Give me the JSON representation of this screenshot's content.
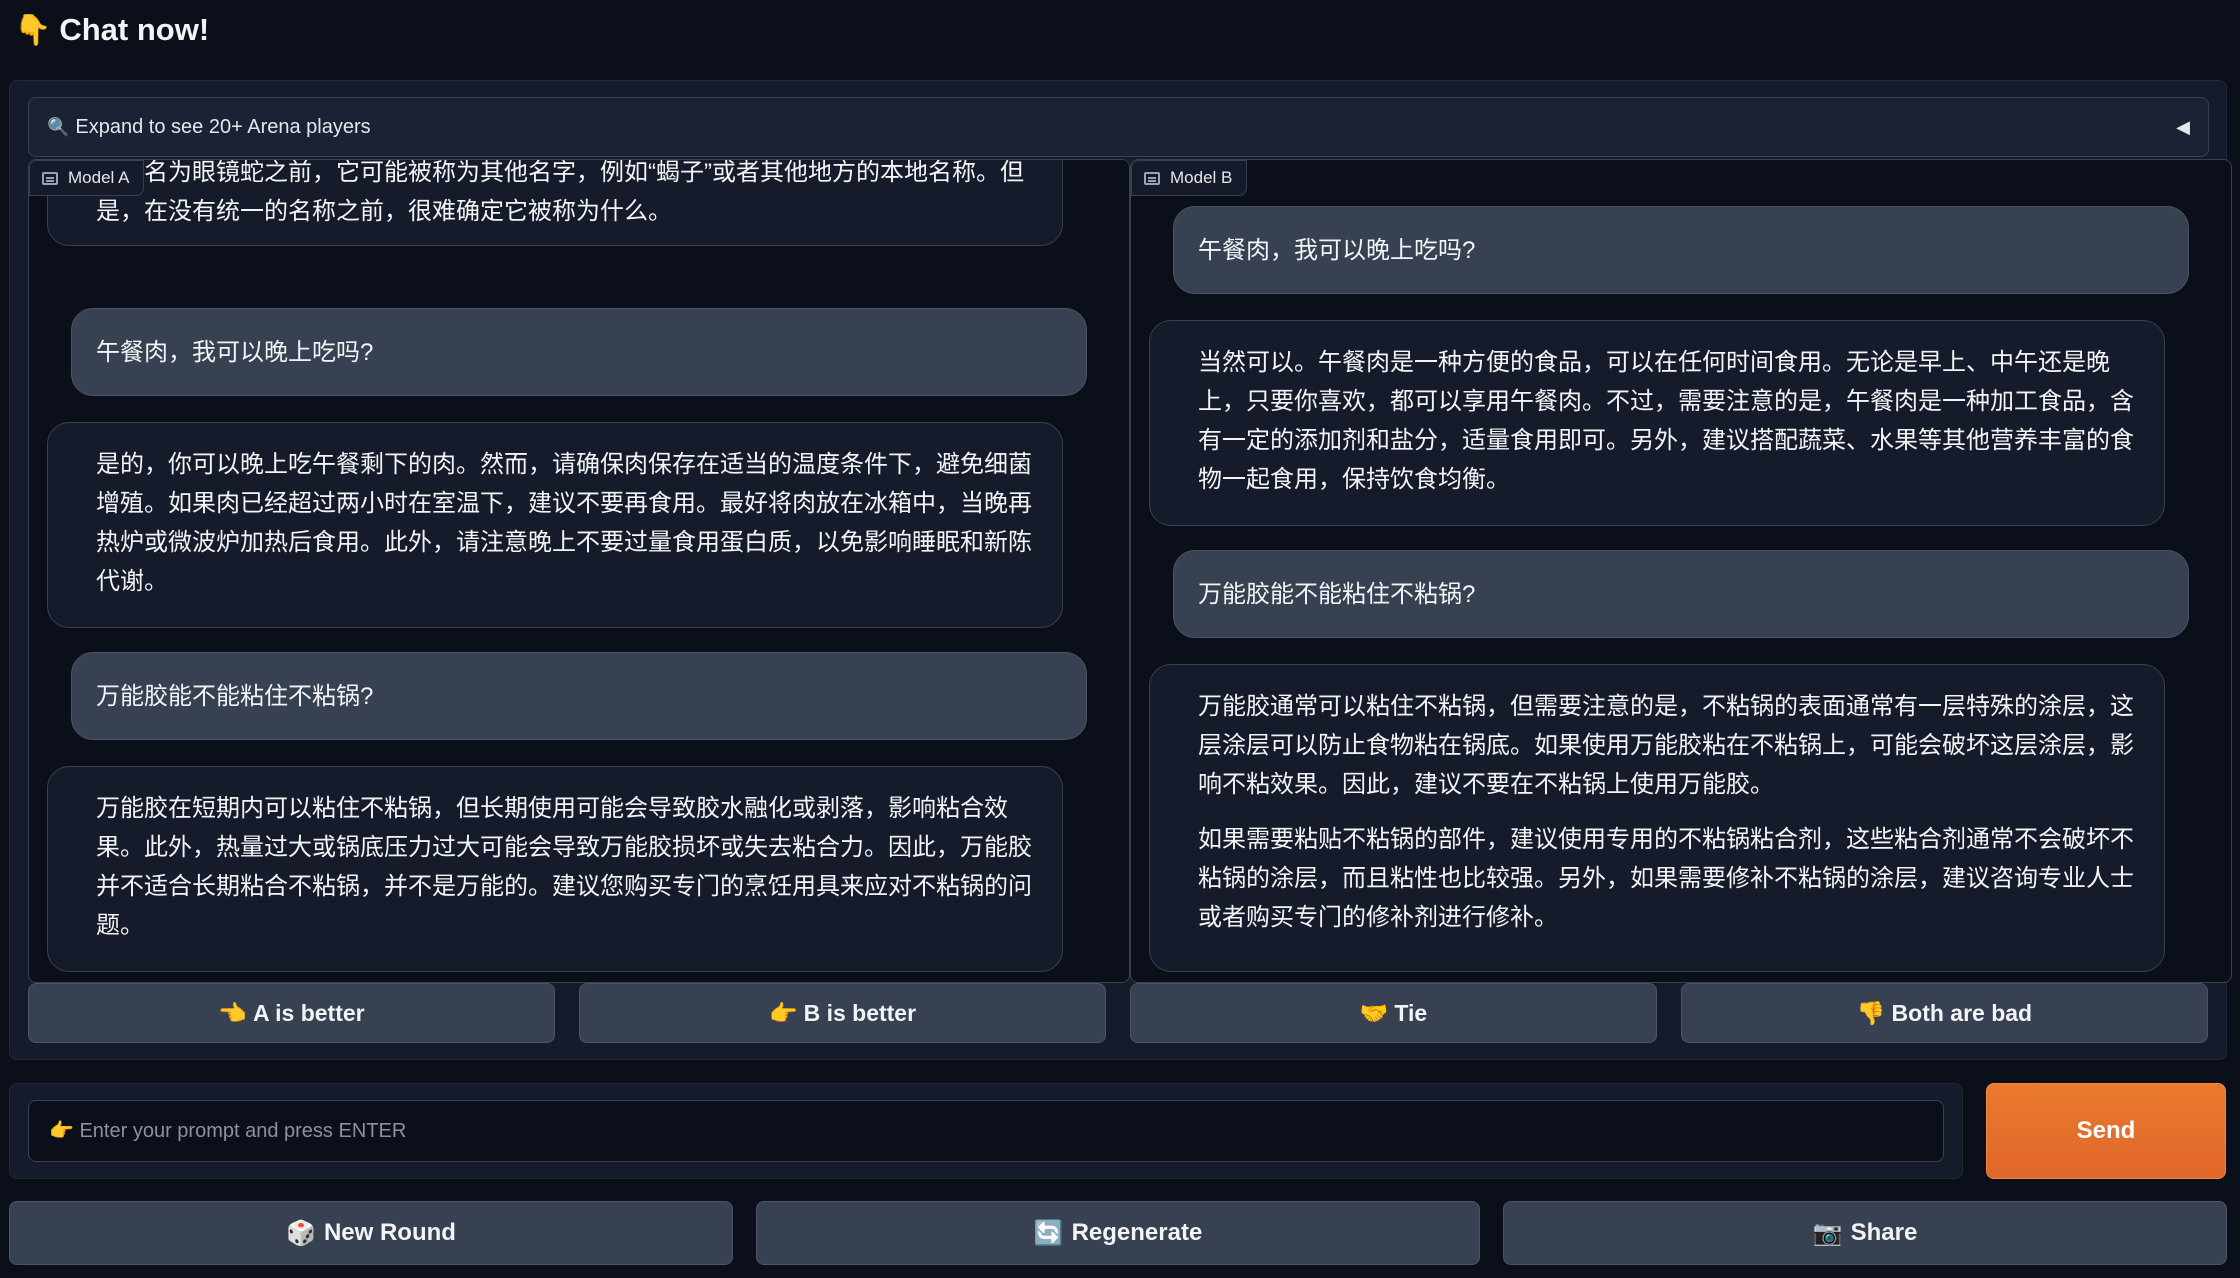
{
  "header": {
    "emoji": "👇",
    "title": "Chat now!"
  },
  "accordion": {
    "icon": "🔍",
    "label": "Expand to see 20+ Arena players",
    "caret": "◀"
  },
  "model_a": {
    "label": "Model A",
    "messages": [
      {
        "role": "bot",
        "paragraphs": [
          "被命名为眼镜蛇之前，它可能被称为其他名字，例如“蝎子”或者其他地方的本地名称。但是，在没有统一的名称之前，很难确定它被称为什么。"
        ]
      },
      {
        "role": "user",
        "text": "午餐肉，我可以晚上吃吗?"
      },
      {
        "role": "bot",
        "paragraphs": [
          "是的，你可以晚上吃午餐剩下的肉。然而，请确保肉保存在适当的温度条件下，避免细菌增殖。如果肉已经超过两小时在室温下，建议不要再食用。最好将肉放在冰箱中，当晚再热炉或微波炉加热后食用。此外，请注意晚上不要过量食用蛋白质，以免影响睡眠和新陈代谢。"
        ]
      },
      {
        "role": "user",
        "text": "万能胶能不能粘住不粘锅?"
      },
      {
        "role": "bot",
        "paragraphs": [
          "万能胶在短期内可以粘住不粘锅，但长期使用可能会导致胶水融化或剥落，影响粘合效果。此外，热量过大或锅底压力过大可能会导致万能胶损坏或失去粘合力。因此，万能胶并不适合长期粘合不粘锅，并不是万能的。建议您购买专门的烹饪用具来应对不粘锅的问题。"
        ]
      }
    ]
  },
  "model_b": {
    "label": "Model B",
    "messages": [
      {
        "role": "user",
        "text": "午餐肉，我可以晚上吃吗?"
      },
      {
        "role": "bot",
        "paragraphs": [
          "当然可以。午餐肉是一种方便的食品，可以在任何时间食用。无论是早上、中午还是晚上，只要你喜欢，都可以享用午餐肉。不过，需要注意的是，午餐肉是一种加工食品，含有一定的添加剂和盐分，适量食用即可。另外，建议搭配蔬菜、水果等其他营养丰富的食物一起食用，保持饮食均衡。"
        ]
      },
      {
        "role": "user",
        "text": "万能胶能不能粘住不粘锅?"
      },
      {
        "role": "bot",
        "paragraphs": [
          "万能胶通常可以粘住不粘锅，但需要注意的是，不粘锅的表面通常有一层特殊的涂层，这层涂层可以防止食物粘在锅底。如果使用万能胶粘在不粘锅上，可能会破坏这层涂层，影响不粘效果。因此，建议不要在不粘锅上使用万能胶。",
          "如果需要粘贴不粘锅的部件，建议使用专用的不粘锅粘合剂，这些粘合剂通常不会破坏不粘锅的涂层，而且粘性也比较强。另外，如果需要修补不粘锅的涂层，建议咨询专业人士或者购买专门的修补剂进行修补。"
        ]
      }
    ]
  },
  "vote": {
    "a_better": {
      "emoji": "👈",
      "label": "A is better"
    },
    "b_better": {
      "emoji": "👉",
      "label": "B is better"
    },
    "tie": {
      "emoji": "🤝",
      "label": "Tie"
    },
    "both_bad": {
      "emoji": "👎",
      "label": "Both are bad"
    }
  },
  "input": {
    "placeholder": "👉 Enter your prompt and press ENTER",
    "value": ""
  },
  "send_label": "Send",
  "actions": {
    "new_round": {
      "emoji": "🎲",
      "label": "New Round"
    },
    "regenerate": {
      "emoji": "🔄",
      "label": "Regenerate"
    },
    "share": {
      "emoji": "📷",
      "label": "Share"
    }
  }
}
